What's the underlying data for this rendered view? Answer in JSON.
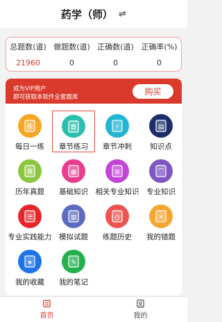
{
  "header": {
    "title": "药学（师）",
    "switch_icon": "⇌"
  },
  "stats": [
    {
      "label": "总题数(道)",
      "value": "21960"
    },
    {
      "label": "做题数(道)",
      "value": "0"
    },
    {
      "label": "正确数(道)",
      "value": "0"
    },
    {
      "label": "正确率(%)",
      "value": "0"
    }
  ],
  "vip": {
    "line1": "成为VIP用户",
    "line2": "即可获取本软件全套题库",
    "buy_label": "购买"
  },
  "grid": [
    {
      "label": "每日一练",
      "icon": "daily-practice-icon",
      "color": "#f5a623",
      "glyph": "练"
    },
    {
      "label": "章节练习",
      "icon": "chapter-practice-icon",
      "color": "#2bbfae",
      "glyph": "章"
    },
    {
      "label": "章节冲刺",
      "icon": "chapter-sprint-icon",
      "color": "#23b5d3",
      "glyph": "⚡"
    },
    {
      "label": "知识点",
      "icon": "knowledge-point-icon",
      "color": "#1c2f6b",
      "glyph": "▤"
    },
    {
      "label": "历年真题",
      "icon": "past-exam-icon",
      "color": "#8cc63f",
      "glyph": "真"
    },
    {
      "label": "基础知识",
      "icon": "basic-knowledge-icon",
      "color": "#e93c8c",
      "glyph": "▦"
    },
    {
      "label": "相关专业知识",
      "icon": "related-knowledge-icon",
      "color": "#c245d6",
      "glyph": "⊞"
    },
    {
      "label": "专业知识",
      "icon": "professional-knowledge-icon",
      "color": "#7e57c2",
      "glyph": "⌒"
    },
    {
      "label": "专业实践能力",
      "icon": "practice-ability-icon",
      "color": "#e8262a",
      "glyph": "☰"
    },
    {
      "label": "模拟试题",
      "icon": "mock-exam-icon",
      "color": "#5c6bc0",
      "glyph": "▥"
    },
    {
      "label": "练题历史",
      "icon": "practice-history-icon",
      "color": "#ef5350",
      "glyph": "◷"
    },
    {
      "label": "我的错题",
      "icon": "wrong-questions-icon",
      "color": "#f7a531",
      "glyph": "✕"
    },
    {
      "label": "我的收藏",
      "icon": "favorites-icon",
      "color": "#1e73e8",
      "glyph": "★"
    },
    {
      "label": "我的笔记",
      "icon": "notes-icon",
      "color": "#22b14c",
      "glyph": "✎"
    }
  ],
  "tabs": [
    {
      "label": "首页",
      "active": true
    },
    {
      "label": "我的",
      "active": false
    }
  ],
  "colors": {
    "accent": "#d93a2c",
    "selected_border": "#e04a3f"
  }
}
